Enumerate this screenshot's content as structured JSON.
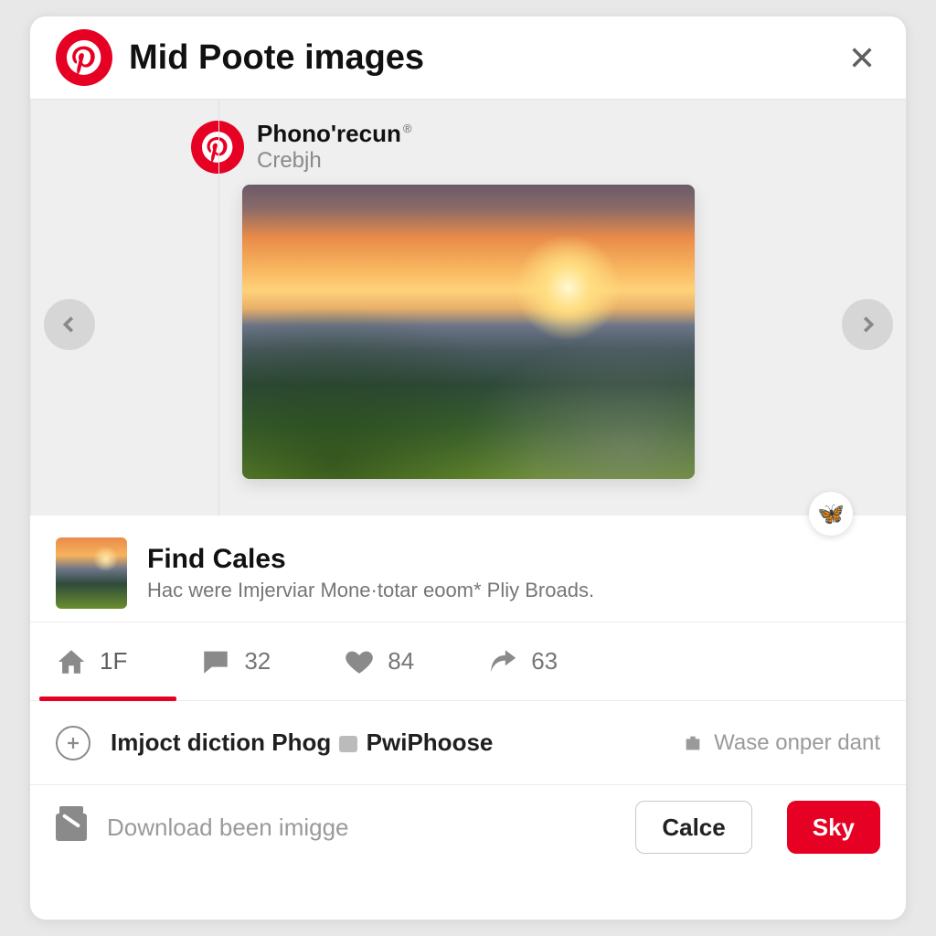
{
  "colors": {
    "brand": "#e60023"
  },
  "header": {
    "title": "Mid Poote images"
  },
  "author": {
    "name": "Phono'recun",
    "badge": "®",
    "subtitle": "Crebjh"
  },
  "detail": {
    "title": "Find Cales",
    "description": "Hac were Imjerviar Mone·totar eoom* Pliy Broads."
  },
  "stats": {
    "home": "1F",
    "comments": "32",
    "likes": "84",
    "shares": "63"
  },
  "row1": {
    "label_a": "Imjoct diction Phog ",
    "label_b": "PwiPhoose",
    "meta": "Wase onper dant"
  },
  "row2": {
    "download_label": "Download been imigge",
    "secondary_btn": "Calce",
    "primary_btn": "Sky"
  },
  "reaction_emoji": "🦋"
}
